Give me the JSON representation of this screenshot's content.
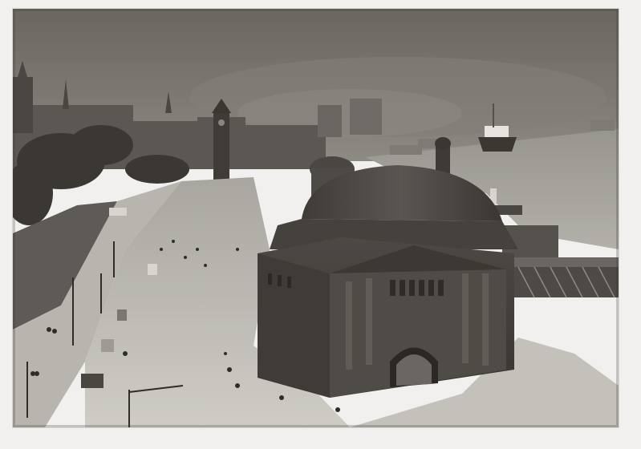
{
  "image": {
    "kind": "sepia photograph postcard",
    "colors": {
      "paper_border": "#f1f0ee",
      "sky": "#6f6b66",
      "haze": "#8b8781",
      "water": "#a9a7a2",
      "road": "#c8c5bf",
      "building_dark": "#3a3632",
      "building_mid": "#58534d",
      "roof": "#4a4641"
    }
  }
}
